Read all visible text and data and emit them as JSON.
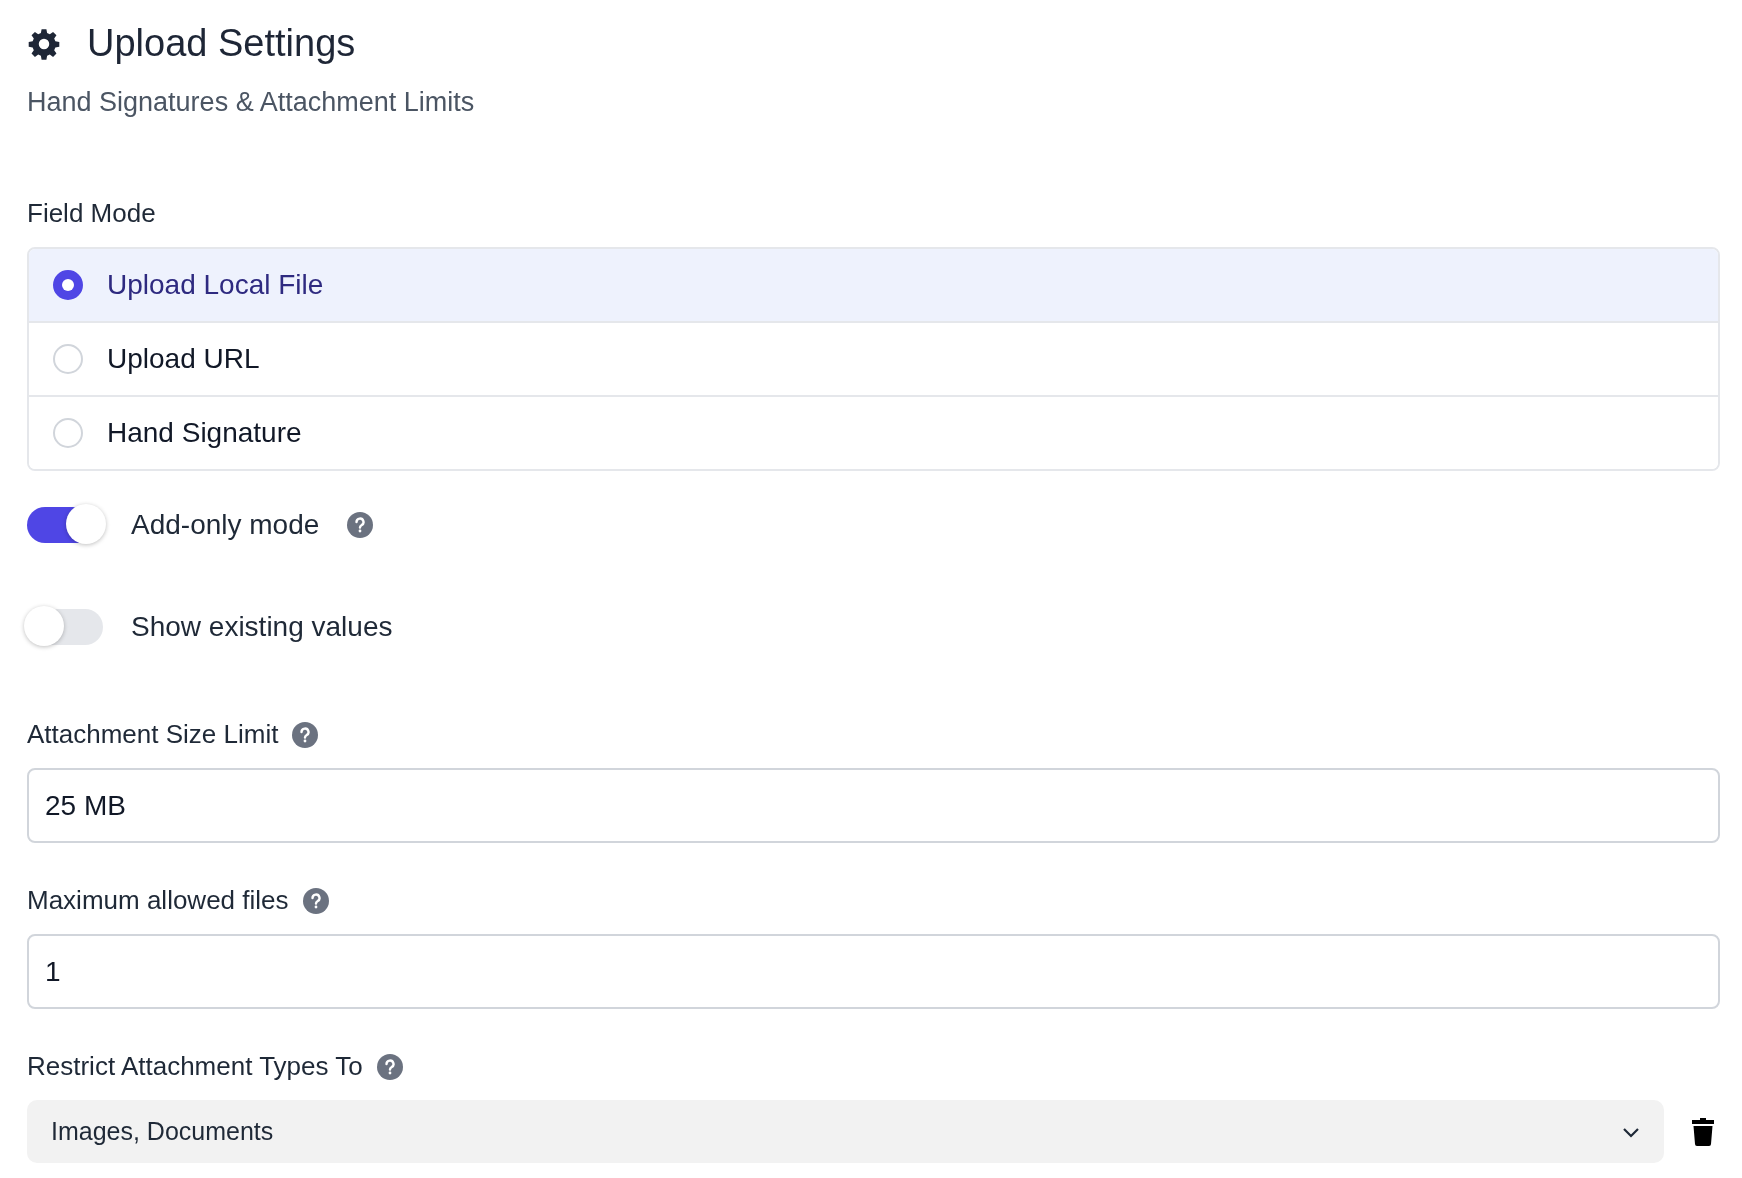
{
  "header": {
    "title": "Upload Settings",
    "subtitle": "Hand Signatures & Attachment Limits"
  },
  "field_mode": {
    "label": "Field Mode",
    "options": [
      {
        "label": "Upload Local File",
        "selected": true
      },
      {
        "label": "Upload URL",
        "selected": false
      },
      {
        "label": "Hand Signature",
        "selected": false
      }
    ]
  },
  "toggles": [
    {
      "label": "Add-only mode",
      "on": true,
      "help": true
    },
    {
      "label": "Show existing values",
      "on": false,
      "help": false
    }
  ],
  "fields": [
    {
      "label": "Attachment Size Limit",
      "value": "25 MB"
    },
    {
      "label": "Maximum allowed files",
      "value": "1"
    }
  ],
  "restrict": {
    "label": "Restrict Attachment Types To",
    "value": "Images, Documents"
  }
}
